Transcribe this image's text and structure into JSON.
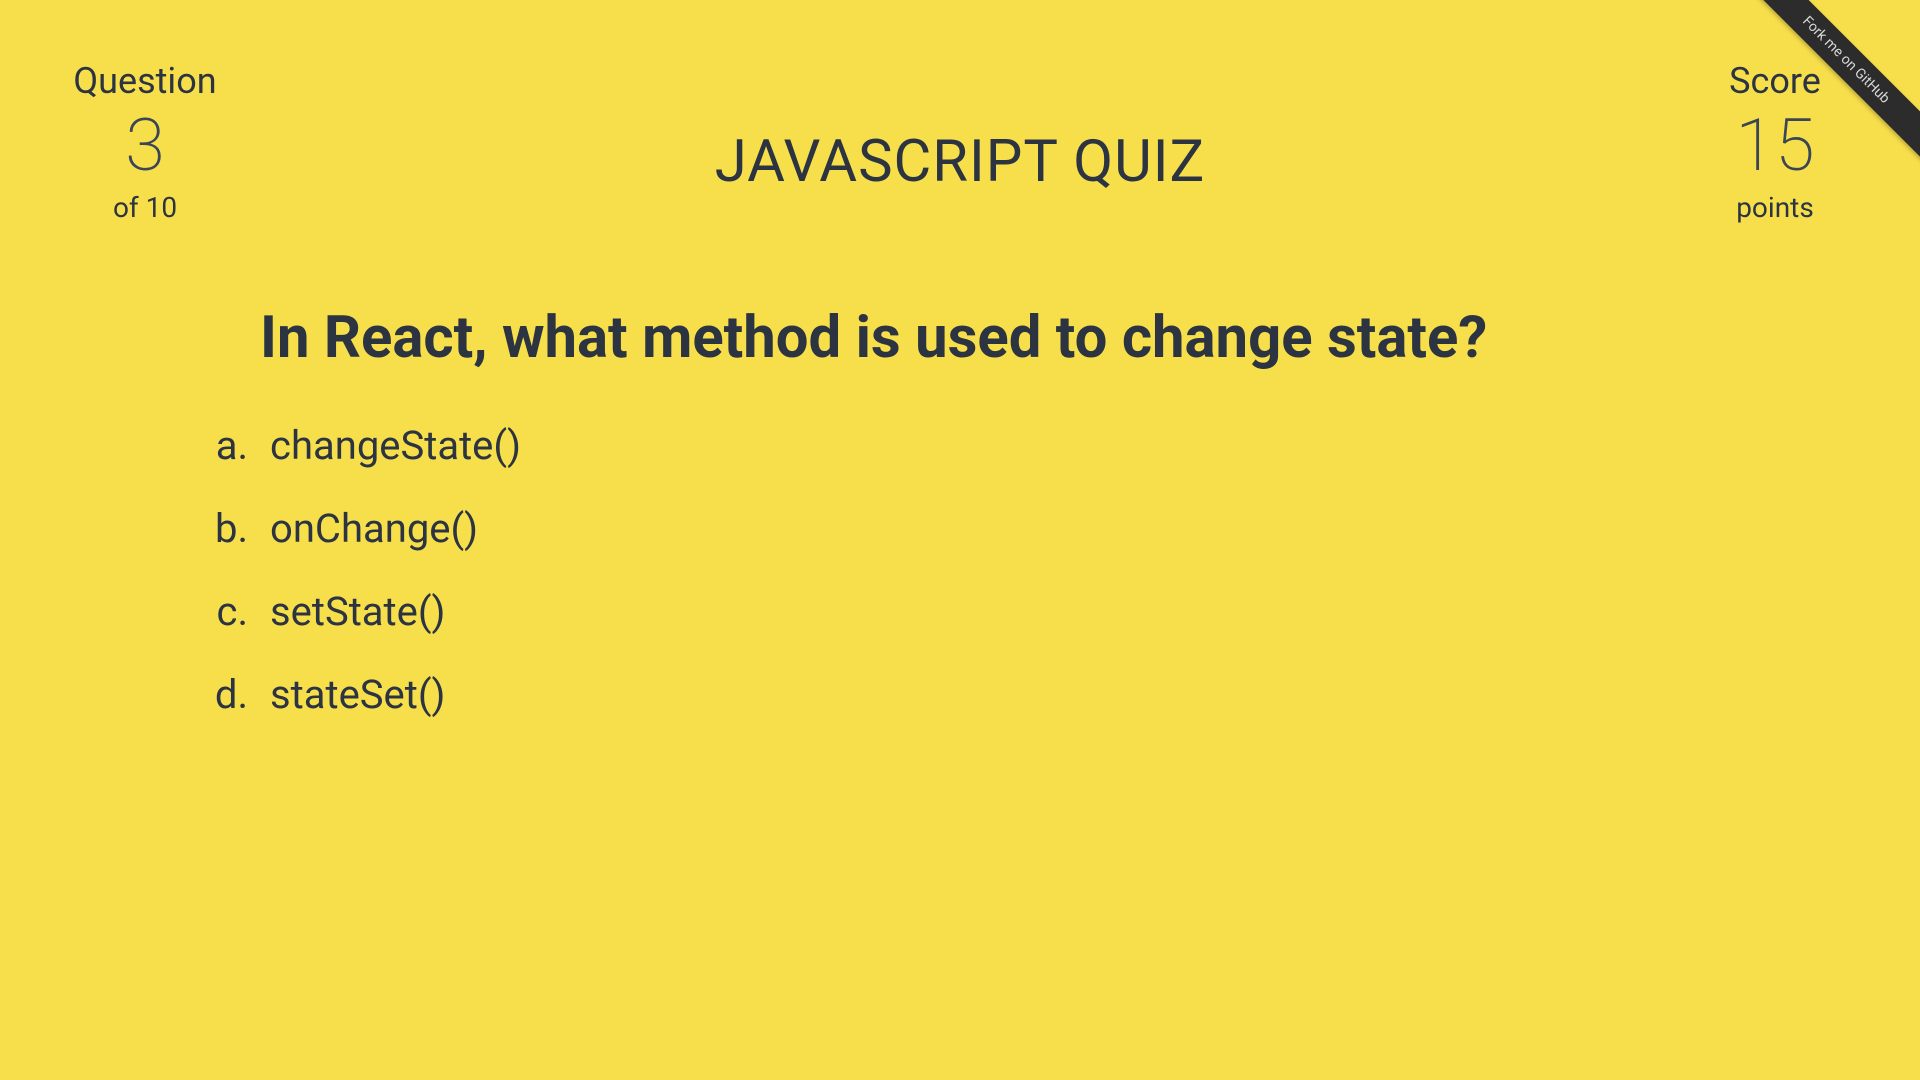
{
  "header": {
    "questionLabel": "Question",
    "questionNumber": "3",
    "questionTotal": "of 10",
    "title": "JAVASCRIPT QUIZ",
    "scoreLabel": "Score",
    "scoreValue": "15",
    "scoreUnit": "points"
  },
  "question": {
    "text": "In React, what method is used to change state?"
  },
  "answers": [
    {
      "letter": "a.",
      "text": "changeState()"
    },
    {
      "letter": "b.",
      "text": "onChange()"
    },
    {
      "letter": "c.",
      "text": "setState()"
    },
    {
      "letter": "d.",
      "text": "stateSet()"
    }
  ],
  "ribbon": {
    "text": "Fork me on GitHub"
  }
}
